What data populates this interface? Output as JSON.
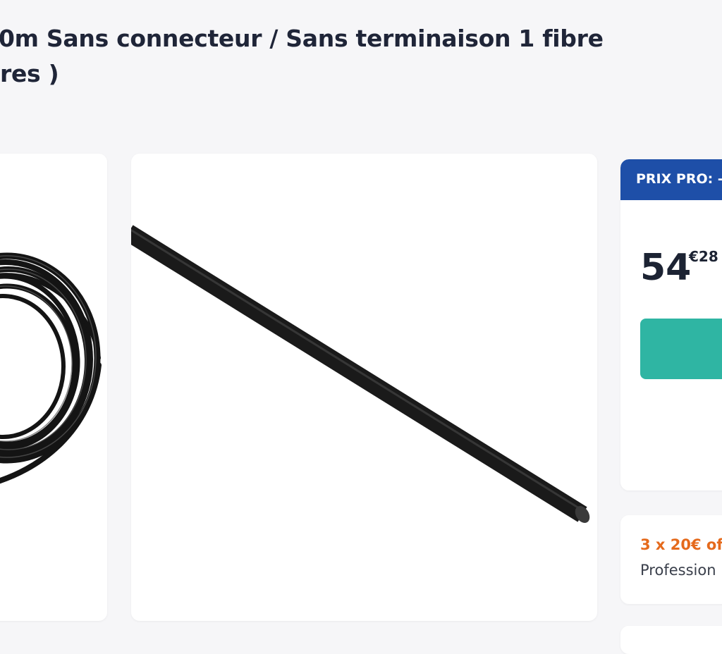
{
  "product": {
    "title_line1": "0m Sans connecteur / Sans terminaison 1 fibre",
    "title_line2": "res )"
  },
  "gallery": {
    "images": [
      {
        "icon": "coiled-cable-image"
      },
      {
        "icon": "straight-cable-image"
      }
    ]
  },
  "pricing": {
    "pro_label": "PRIX PRO: -",
    "price_integer": "54",
    "price_cents": "€28",
    "accent_color": "#2fb5a3",
    "header_color": "#1e4fa8"
  },
  "offer": {
    "title": "3 x 20€ of",
    "subtitle": "Profession",
    "title_color": "#e56a1c"
  }
}
